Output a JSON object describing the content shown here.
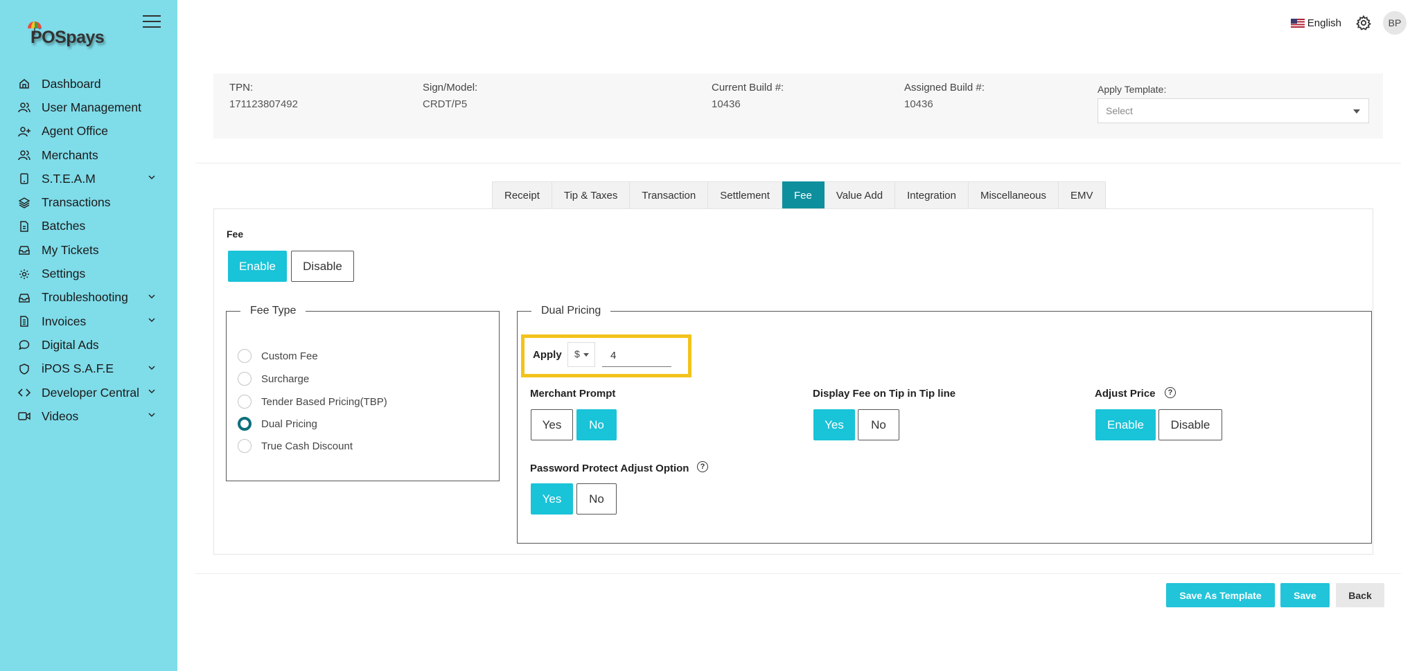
{
  "app": {
    "logo_text": "POSpays"
  },
  "sidebar": {
    "items": [
      {
        "label": "Dashboard",
        "icon": "home-icon",
        "chevron": false
      },
      {
        "label": "User Management",
        "icon": "users-icon",
        "chevron": false
      },
      {
        "label": "Agent Office",
        "icon": "user-plus-icon",
        "chevron": false
      },
      {
        "label": "Merchants",
        "icon": "users-icon",
        "chevron": false
      },
      {
        "label": "S.T.E.A.M",
        "icon": "tablet-icon",
        "chevron": true
      },
      {
        "label": "Transactions",
        "icon": "layers-icon",
        "chevron": false
      },
      {
        "label": "Batches",
        "icon": "file-icon",
        "chevron": false
      },
      {
        "label": "My Tickets",
        "icon": "inbox-icon",
        "chevron": false
      },
      {
        "label": "Settings",
        "icon": "gear-icon",
        "chevron": false
      },
      {
        "label": "Troubleshooting",
        "icon": "inbox-icon",
        "chevron": true
      },
      {
        "label": "Invoices",
        "icon": "document-icon",
        "chevron": true
      },
      {
        "label": "Digital Ads",
        "icon": "message-icon",
        "chevron": false
      },
      {
        "label": "iPOS S.A.F.E",
        "icon": "shield-icon",
        "chevron": true
      },
      {
        "label": "Developer Central",
        "icon": "code-icon",
        "chevron": true
      },
      {
        "label": "Videos",
        "icon": "video-icon",
        "chevron": true
      }
    ]
  },
  "topbar": {
    "language": "English",
    "avatar_initials": "BP"
  },
  "info": {
    "tpn_label": "TPN:",
    "tpn_value": "171123807492",
    "model_label": "Sign/Model:",
    "model_value": "CRDT/P5",
    "current_build_label": "Current Build #:",
    "current_build_value": "10436",
    "assigned_build_label": "Assigned Build #:",
    "assigned_build_value": "10436",
    "template_label": "Apply Template:",
    "template_placeholder": "Select"
  },
  "tabs": [
    {
      "label": "Receipt",
      "active": false
    },
    {
      "label": "Tip & Taxes",
      "active": false
    },
    {
      "label": "Transaction",
      "active": false
    },
    {
      "label": "Settlement",
      "active": false
    },
    {
      "label": "Fee",
      "active": true
    },
    {
      "label": "Value Add",
      "active": false
    },
    {
      "label": "Integration",
      "active": false
    },
    {
      "label": "Miscellaneous",
      "active": false
    },
    {
      "label": "EMV",
      "active": false
    }
  ],
  "fee": {
    "label": "Fee",
    "enable_label": "Enable",
    "disable_label": "Disable",
    "enabled": true
  },
  "fee_type": {
    "legend": "Fee Type",
    "options": [
      {
        "label": "Custom Fee",
        "checked": false
      },
      {
        "label": "Surcharge",
        "checked": false
      },
      {
        "label": "Tender Based Pricing(TBP)",
        "checked": false
      },
      {
        "label": "Dual Pricing",
        "checked": true
      },
      {
        "label": "True Cash Discount",
        "checked": false
      }
    ]
  },
  "dual_pricing": {
    "legend": "Dual Pricing",
    "apply_label": "Apply",
    "apply_unit": "$",
    "apply_value": "4",
    "merchant_prompt_label": "Merchant Prompt",
    "merchant_prompt_yes": "Yes",
    "merchant_prompt_no": "No",
    "merchant_prompt_selected": "No",
    "display_fee_label": "Display Fee on Tip in Tip line",
    "display_fee_yes": "Yes",
    "display_fee_no": "No",
    "display_fee_selected": "Yes",
    "adjust_price_label": "Adjust Price",
    "adjust_enable": "Enable",
    "adjust_disable": "Disable",
    "adjust_selected": "Enable",
    "password_protect_label": "Password Protect Adjust Option",
    "password_yes": "Yes",
    "password_no": "No",
    "password_selected": "Yes",
    "help_glyph": "?"
  },
  "actions": {
    "save_template_label": "Save As Template",
    "save_label": "Save",
    "back_label": "Back"
  },
  "colors": {
    "sidebar_bg": "#7fdce9",
    "accent": "#19c3d8",
    "active_tab": "#0e8f9e",
    "highlight": "#f3c31b"
  }
}
